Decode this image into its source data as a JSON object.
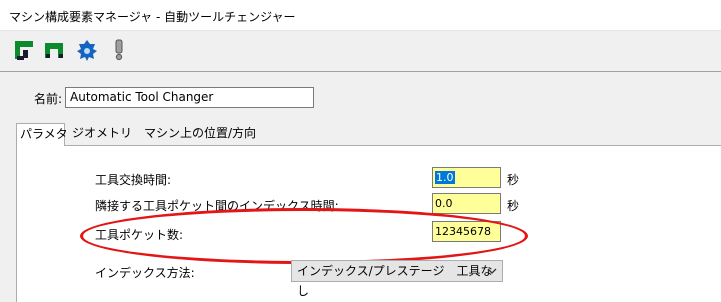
{
  "window": {
    "title": "マシン構成要素マネージャ - 自動ツールチェンジャー"
  },
  "toolbar": {
    "icons": [
      "gantry-green-icon",
      "bridge-green-icon",
      "gear-blue-icon",
      "exclamation-icon"
    ]
  },
  "name": {
    "label": "名前:",
    "value": "Automatic Tool Changer"
  },
  "tabs": [
    {
      "label": "パラメタ",
      "active": true
    },
    {
      "label": "ジオメトリ",
      "active": false
    },
    {
      "label": "マシン上の位置/方向",
      "active": false
    }
  ],
  "params": {
    "tool_change_time": {
      "label": "工具交換時間:",
      "value": "1.0",
      "unit": "秒"
    },
    "index_time": {
      "label": "隣接する工具ポケット間のインデックス時間:",
      "value": "0.0",
      "unit": "秒"
    },
    "pocket_count": {
      "label": "工具ポケット数:",
      "value": "12345678"
    },
    "index_method": {
      "label": "インデックス方法:",
      "selected": "インデックス/プレステージ　工具なし"
    }
  },
  "colors": {
    "input_highlight": "#ffff99",
    "annotation_circle": "#e31515",
    "selection": "#0078d7"
  }
}
